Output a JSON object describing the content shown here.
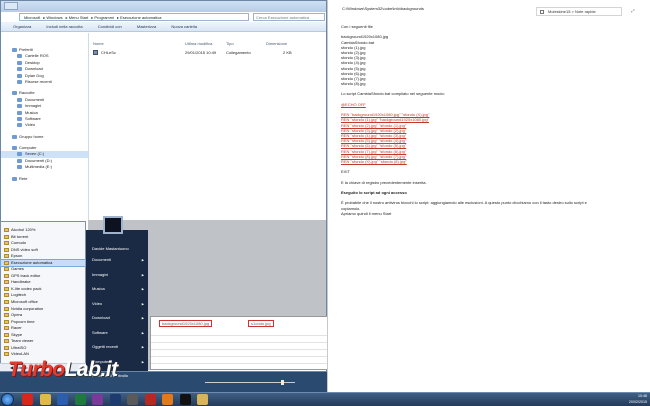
{
  "explorer": {
    "address": [
      "Microsoft",
      "Windows",
      "Menu Start",
      "Programmi",
      "Esecuzione automatica"
    ],
    "search_placeholder": "Cerca Esecuzione automatica",
    "toolbar": [
      "Organizza",
      "Includi nella raccolta",
      "Condividi con",
      "Masterizza",
      "Nuova cartella"
    ],
    "nav": {
      "favorites": "Preferiti",
      "fav_items": [
        "Cartelle ROS",
        "Desktop",
        "Download",
        "Dylan Dog",
        "Risorse recenti"
      ],
      "libraries": "Raccolte",
      "lib_items": [
        "Documenti",
        "Immagini",
        "Musica",
        "Software",
        "Video"
      ],
      "homegroup": "Gruppo home",
      "computer": "Computer",
      "drives": [
        "Seven (C:)",
        "Documenti (D:)",
        "Multimedia (E:)"
      ],
      "network": "Rete"
    },
    "columns": [
      "Nome",
      "Ultima modifica",
      "Tipo",
      "Dimensione"
    ],
    "file": {
      "name": "CHLeSc",
      "modified": "29/01/2015 10:49",
      "type": "Collegamento",
      "size": "2 KB"
    }
  },
  "excel": {
    "cell1": "background1920x1080.jpg",
    "cell2": "s1ondo.jpg"
  },
  "startmenu": {
    "programs": [
      "Alcohol 120%",
      "Bit torrent",
      "Comodo",
      "DNS video soft",
      "Epson",
      "Esecuzione automatica",
      "Games",
      "GPS track editor",
      "Handbrake",
      "K-lite codec pack",
      "Logitech",
      "Microsoft office",
      "Nvidia corporation",
      "Opera",
      "Popcorn time",
      "Racer",
      "Skype",
      "Team viewer",
      "UltraISO",
      "VideoLAN"
    ],
    "selected_index": 5,
    "back_label": "Indietro",
    "right": [
      "Davide Mastantuono",
      "Documenti",
      "Immagini",
      "Musica",
      "Video",
      "Download",
      "Software",
      "Oggetti recenti",
      "Computer",
      "Pannello di controllo"
    ],
    "right_arrows": [
      false,
      true,
      true,
      true,
      true,
      true,
      true,
      true,
      true,
      false
    ]
  },
  "doc": {
    "path": "C:\\Windows\\System32\\oobe\\info\\backgrounds",
    "notebook": "Moleskine15 > Note rapide",
    "expand_icon": "⤢",
    "lines": [
      {
        "t": "Con i seguenti file",
        "s": "n"
      },
      {
        "t": "",
        "s": "gap"
      },
      {
        "t": "background1920x1080.jpg",
        "s": "n"
      },
      {
        "t": "CambiaSfondo.bat",
        "s": "n"
      },
      {
        "t": "sfondo (1).jpg",
        "s": "n"
      },
      {
        "t": "sfondo (2).jpg",
        "s": "n"
      },
      {
        "t": "sfondo (3).jpg",
        "s": "n"
      },
      {
        "t": "sfondo (4).jpg",
        "s": "n"
      },
      {
        "t": "sfondo (5).jpg",
        "s": "n"
      },
      {
        "t": "sfondo (6).jpg",
        "s": "n"
      },
      {
        "t": "sfondo (7).jpg",
        "s": "n"
      },
      {
        "t": "sfondo (8).jpg",
        "s": "n"
      },
      {
        "t": "",
        "s": "gap"
      },
      {
        "t": "Lo script CambiaSfondo.bat compilato nel seguente modo:",
        "s": "n"
      },
      {
        "t": "",
        "s": "gap"
      },
      {
        "t": "@ECHO OFF",
        "s": "r"
      },
      {
        "t": "",
        "s": "gap"
      },
      {
        "t": "REN \"background1920x1080.jpg\" \"sfondo (X).jpg\"",
        "s": "r"
      },
      {
        "t": "REN \"sfondo (1).jpg\" \"background1920x1080.jpg\"",
        "s": "r"
      },
      {
        "t": "REN \"sfondo (2).jpg\" \"sfondo (1).jpg\"",
        "s": "r"
      },
      {
        "t": "REN \"sfondo (3).jpg\" \"sfondo (2).jpg\"",
        "s": "r"
      },
      {
        "t": "REN \"sfondo (4).jpg\" \"sfondo (3).jpg\"",
        "s": "r"
      },
      {
        "t": "REN \"sfondo (5).jpg\" \"sfondo (4).jpg\"",
        "s": "r"
      },
      {
        "t": "REN \"sfondo (6).jpg\" \"sfondo (5).jpg\"",
        "s": "r"
      },
      {
        "t": "REN \"sfondo (7).jpg\" \"sfondo (6).jpg\"",
        "s": "r"
      },
      {
        "t": "REN \"sfondo (8).jpg\" \"sfondo (7).jpg\"",
        "s": "r"
      },
      {
        "t": "REN \"sfondo (X).jpg\" \"sfondo (8).jpg\"",
        "s": "r"
      },
      {
        "t": "",
        "s": "gap"
      },
      {
        "t": "EXIT",
        "s": "n"
      },
      {
        "t": "",
        "s": "gap"
      },
      {
        "t": "E la chiave di registro precedentemente inserita.",
        "s": "n"
      },
      {
        "t": "",
        "s": "gap"
      },
      {
        "t": "Eseguito lo script ad ogni accesso",
        "s": "b"
      },
      {
        "t": "",
        "s": "gap"
      },
      {
        "t": "È probabile che il nostro antivirus blocchi lo script: aggiungiamolo alle esclusioni. A questo punto clicchiamo con il tasto destro sullo script e",
        "s": "n"
      },
      {
        "t": "copiamolo.",
        "s": "n"
      },
      {
        "t": "Apriamo quindi il menu Start",
        "s": "n"
      }
    ]
  },
  "taskbar": {
    "time": "10:48",
    "date": "20/02/2015",
    "icons": [
      {
        "name": "opera-icon",
        "color": "#d8261e"
      },
      {
        "name": "explorer-icon",
        "color": "#e0b84c"
      },
      {
        "name": "word-icon",
        "color": "#2b5fad"
      },
      {
        "name": "excel-icon",
        "color": "#1f7a3e"
      },
      {
        "name": "onenote-icon",
        "color": "#7b3a99"
      },
      {
        "name": "photoshop-icon",
        "color": "#1d3b6e"
      },
      {
        "name": "media-icon",
        "color": "#5a5a5a"
      },
      {
        "name": "filezilla-icon",
        "color": "#b52a20"
      },
      {
        "name": "firefox-icon",
        "color": "#e07a1f"
      },
      {
        "name": "cmd-icon",
        "color": "#111111"
      },
      {
        "name": "folder-icon",
        "color": "#d9b45a"
      }
    ]
  },
  "watermark": {
    "brand": "TurboLab.it"
  }
}
